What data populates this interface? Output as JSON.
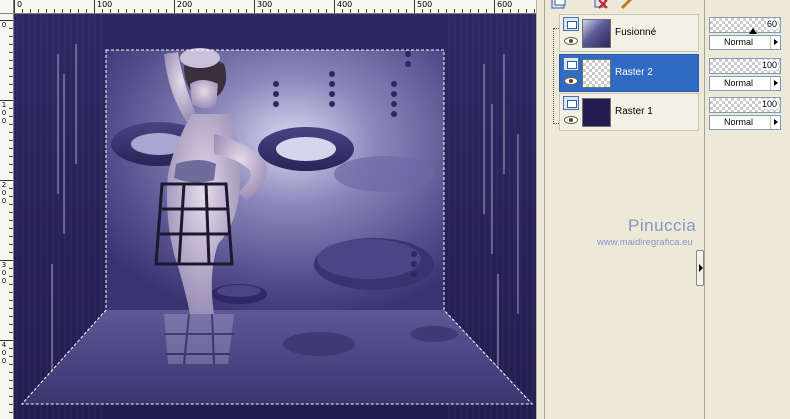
{
  "ruler": {
    "top_labels": [
      "0",
      "100",
      "200",
      "300",
      "400",
      "500",
      "600"
    ],
    "left_labels": [
      "0",
      "1\n0\n0",
      "2\n0\n0",
      "3\n0\n0",
      "4\n0\n0"
    ]
  },
  "layers": [
    {
      "name": "Fusionné",
      "thumb": "image",
      "visible": true,
      "selected": false
    },
    {
      "name": "Raster 2",
      "thumb": "transparent",
      "visible": true,
      "selected": true
    },
    {
      "name": "Raster 1",
      "thumb": "solid",
      "visible": true,
      "selected": false
    }
  ],
  "properties": [
    {
      "opacity": "60",
      "blend": "Normal"
    },
    {
      "opacity": "100",
      "blend": "Normal"
    },
    {
      "opacity": "100",
      "blend": "Normal"
    }
  ],
  "watermark": {
    "name": "Pinuccia",
    "url": "www.maidiregrafica.eu"
  },
  "colors": {
    "canvas_bg": "#2a2358",
    "selection_highlight": "#316ac5",
    "panel_bg": "#ece9d8"
  },
  "icons": {
    "toolbar": [
      "new-layer-icon",
      "delete-layer-icon",
      "edit-icon"
    ]
  }
}
